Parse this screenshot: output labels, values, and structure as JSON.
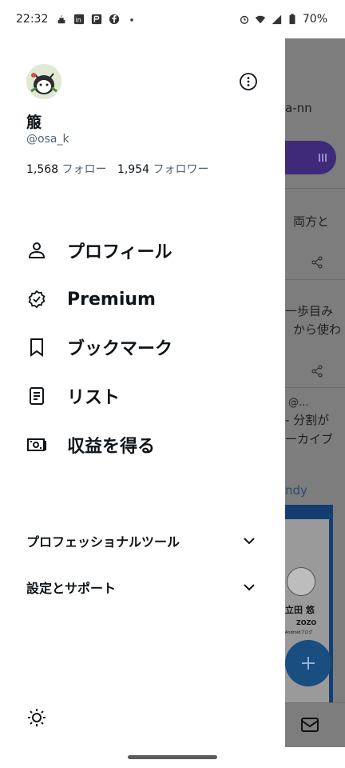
{
  "status_bar": {
    "time": "22:32",
    "battery": "70%",
    "app_icons": [
      "cake-icon",
      "linkedin-icon",
      "pdf-icon",
      "facebook-icon",
      "dot-icon"
    ],
    "system_icons": [
      "alarm-icon",
      "wifi-icon",
      "signal-icon",
      "battery-icon"
    ]
  },
  "drawer": {
    "profile": {
      "display_name": "箙",
      "handle": "@osa_k",
      "following_count": "1,568",
      "following_label": "フォロー",
      "followers_count": "1,954",
      "followers_label": "フォロワー"
    },
    "menu": [
      {
        "label": "プロフィール",
        "icon": "person-icon"
      },
      {
        "label": "Premium",
        "icon": "verified-badge-icon"
      },
      {
        "label": "ブックマーク",
        "icon": "bookmark-icon"
      },
      {
        "label": "リスト",
        "icon": "list-icon"
      },
      {
        "label": "収益を得る",
        "icon": "money-icon"
      }
    ],
    "sections": [
      {
        "label": "プロフェッショナルツール"
      },
      {
        "label": "設定とサポート"
      }
    ]
  },
  "background": {
    "texts": [
      "a-nn",
      "両方と",
      "一歩目み",
      "から使わ",
      "@...",
      "- 分割が",
      "ーカイブ",
      "ndy",
      "立田 悠",
      "ZOZO",
      "Androidブログ"
    ]
  },
  "colors": {
    "accent": "#1d9bf0",
    "premium_purple": "#3e2a78",
    "text_secondary": "#536471",
    "scrim": "#7d7d7d"
  }
}
